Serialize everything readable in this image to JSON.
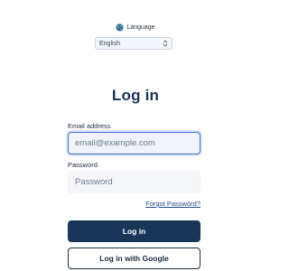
{
  "language": {
    "label": "Language",
    "selected": "English"
  },
  "login": {
    "title": "Log in",
    "email_label": "Email address",
    "email_placeholder": "email@example.com",
    "email_value": "",
    "password_label": "Password",
    "password_placeholder": "Password",
    "password_value": "",
    "forgot_password": "Forgot Password?",
    "login_button": "Log in",
    "google_button": "Log in with Google"
  },
  "colors": {
    "primary": "#193658",
    "focus_border": "#3b6fd0",
    "link": "#1b4a8a"
  },
  "icons": {
    "language": "globe-icon",
    "select": "chevron-updown-icon"
  }
}
